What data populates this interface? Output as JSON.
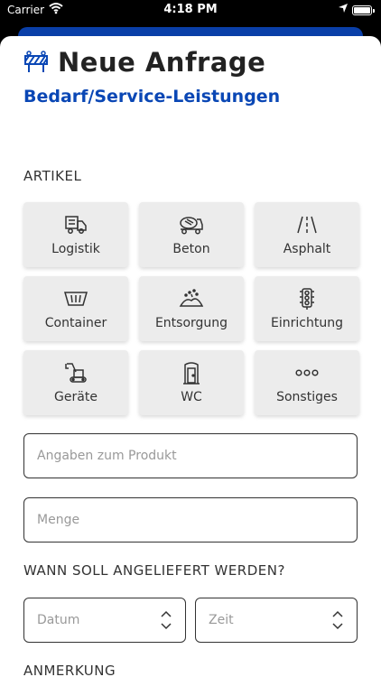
{
  "status_bar": {
    "carrier": "Carrier",
    "time": "4:18 PM"
  },
  "header": {
    "title": "Neue Anfrage",
    "subtitle": "Bedarf/Service-Leistungen"
  },
  "sections": {
    "artikel": "ARTIKEL",
    "wann": "WANN SOLL ANGELIEFERT WERDEN?",
    "anmerkung": "ANMERKUNG"
  },
  "tiles": [
    {
      "label": "Logistik",
      "icon": "truck-icon"
    },
    {
      "label": "Beton",
      "icon": "concrete-mixer-icon"
    },
    {
      "label": "Asphalt",
      "icon": "road-icon"
    },
    {
      "label": "Container",
      "icon": "container-icon"
    },
    {
      "label": "Entsorgung",
      "icon": "waste-disposal-icon"
    },
    {
      "label": "Einrichtung",
      "icon": "traffic-light-icon"
    },
    {
      "label": "Geräte",
      "icon": "excavator-icon"
    },
    {
      "label": "WC",
      "icon": "toilet-door-icon"
    },
    {
      "label": "Sonstiges",
      "icon": "more-icon"
    }
  ],
  "form": {
    "product_placeholder": "Angaben zum Produkt",
    "quantity_placeholder": "Menge",
    "date_placeholder": "Datum",
    "time_placeholder": "Zeit"
  },
  "colors": {
    "accent": "#0a47b5",
    "sheet_back": "#0a3fa8",
    "tile_bg": "#ececec"
  }
}
